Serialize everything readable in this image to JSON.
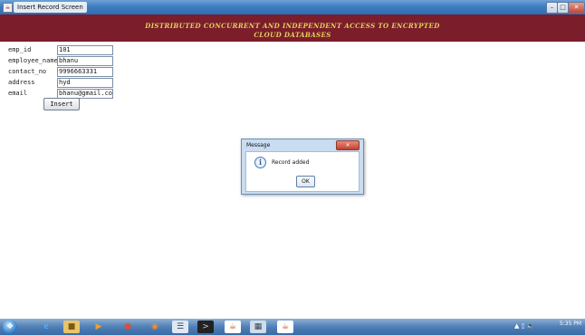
{
  "window": {
    "title": "Insert Record Screen",
    "icon": "java-cup-icon",
    "buttons": {
      "minimize": "–",
      "maximize": "□",
      "close": "✕"
    }
  },
  "header": {
    "line1": "DISTRIBUTED CONCURRENT AND INDEPENDENT ACCESS TO ENCRYPTED",
    "line2": "CLOUD DATABASES",
    "background": "#7b1d2b",
    "text_color": "#e2d35a"
  },
  "form": {
    "fields": [
      {
        "label": "emp_id",
        "value": "101"
      },
      {
        "label": "employee_name",
        "value": "bhanu"
      },
      {
        "label": "contact_no",
        "value": "9996663331"
      },
      {
        "label": "address",
        "value": "hyd"
      },
      {
        "label": "email",
        "value": "bhanu@gmail.com"
      }
    ],
    "insert_label": "Insert"
  },
  "dialog": {
    "title": "Message",
    "message": "Record added",
    "ok_label": "OK",
    "close_label": "✕",
    "icon": "info-icon"
  },
  "taskbar": {
    "start_icon": "windows-start-icon",
    "icons": [
      "ie-icon",
      "folder-icon",
      "media-player-icon",
      "chrome-icon",
      "firefox-icon",
      "notepad-icon",
      "cmd-icon",
      "java-icon",
      "explorer-icon",
      "java-icon"
    ],
    "clock_time": "5:35 PM"
  }
}
